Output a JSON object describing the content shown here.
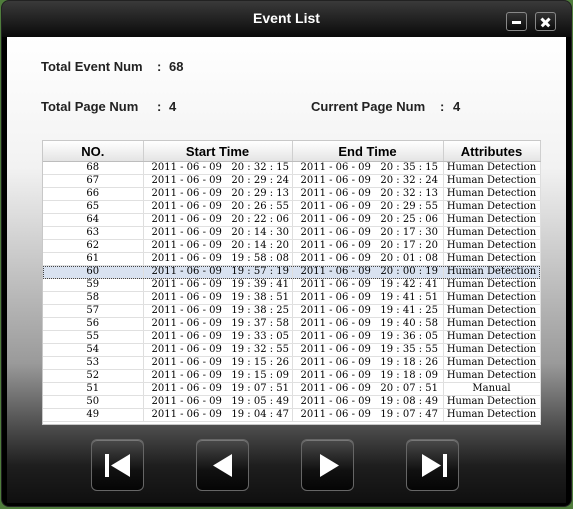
{
  "window": {
    "title": "Event List"
  },
  "info": {
    "total_event_label": "Total Event Num",
    "total_event_value": "68",
    "total_page_label": "Total Page Num",
    "total_page_value": "4",
    "current_page_label": "Current Page Num",
    "current_page_value": "4",
    "separator": ":"
  },
  "table": {
    "headers": [
      "NO.",
      "Start Time",
      "End Time",
      "Attributes"
    ],
    "rows": [
      {
        "no": "68",
        "start": "2011 - 06 - 09   20 : 32 : 15",
        "end": "2011 - 06 - 09   20 : 35 : 15",
        "attr": "Human Detection"
      },
      {
        "no": "67",
        "start": "2011 - 06 - 09   20 : 29 : 24",
        "end": "2011 - 06 - 09   20 : 32 : 24",
        "attr": "Human Detection"
      },
      {
        "no": "66",
        "start": "2011 - 06 - 09   20 : 29 : 13",
        "end": "2011 - 06 - 09   20 : 32 : 13",
        "attr": "Human Detection"
      },
      {
        "no": "65",
        "start": "2011 - 06 - 09   20 : 26 : 55",
        "end": "2011 - 06 - 09   20 : 29 : 55",
        "attr": "Human Detection"
      },
      {
        "no": "64",
        "start": "2011 - 06 - 09   20 : 22 : 06",
        "end": "2011 - 06 - 09   20 : 25 : 06",
        "attr": "Human Detection"
      },
      {
        "no": "63",
        "start": "2011 - 06 - 09   20 : 14 : 30",
        "end": "2011 - 06 - 09   20 : 17 : 30",
        "attr": "Human Detection"
      },
      {
        "no": "62",
        "start": "2011 - 06 - 09   20 : 14 : 20",
        "end": "2011 - 06 - 09   20 : 17 : 20",
        "attr": "Human Detection"
      },
      {
        "no": "61",
        "start": "2011 - 06 - 09   19 : 58 : 08",
        "end": "2011 - 06 - 09   20 : 01 : 08",
        "attr": "Human Detection"
      },
      {
        "no": "60",
        "start": "2011 - 06 - 09   19 : 57 : 19",
        "end": "2011 - 06 - 09   20 : 00 : 19",
        "attr": "Human Detection",
        "selected": true
      },
      {
        "no": "59",
        "start": "2011 - 06 - 09   19 : 39 : 41",
        "end": "2011 - 06 - 09   19 : 42 : 41",
        "attr": "Human Detection"
      },
      {
        "no": "58",
        "start": "2011 - 06 - 09   19 : 38 : 51",
        "end": "2011 - 06 - 09   19 : 41 : 51",
        "attr": "Human Detection"
      },
      {
        "no": "57",
        "start": "2011 - 06 - 09   19 : 38 : 25",
        "end": "2011 - 06 - 09   19 : 41 : 25",
        "attr": "Human Detection"
      },
      {
        "no": "56",
        "start": "2011 - 06 - 09   19 : 37 : 58",
        "end": "2011 - 06 - 09   19 : 40 : 58",
        "attr": "Human Detection"
      },
      {
        "no": "55",
        "start": "2011 - 06 - 09   19 : 33 : 05",
        "end": "2011 - 06 - 09   19 : 36 : 05",
        "attr": "Human Detection"
      },
      {
        "no": "54",
        "start": "2011 - 06 - 09   19 : 32 : 55",
        "end": "2011 - 06 - 09   19 : 35 : 55",
        "attr": "Human Detection"
      },
      {
        "no": "53",
        "start": "2011 - 06 - 09   19 : 15 : 26",
        "end": "2011 - 06 - 09   19 : 18 : 26",
        "attr": "Human Detection"
      },
      {
        "no": "52",
        "start": "2011 - 06 - 09   19 : 15 : 09",
        "end": "2011 - 06 - 09   19 : 18 : 09",
        "attr": "Human Detection"
      },
      {
        "no": "51",
        "start": "2011 - 06 - 09   19 : 07 : 51",
        "end": "2011 - 06 - 09   20 : 07 : 51",
        "attr": "Manual"
      },
      {
        "no": "50",
        "start": "2011 - 06 - 09   19 : 05 : 49",
        "end": "2011 - 06 - 09   19 : 08 : 49",
        "attr": "Human Detection"
      },
      {
        "no": "49",
        "start": "2011 - 06 - 09   19 : 04 : 47",
        "end": "2011 - 06 - 09   19 : 07 : 47",
        "attr": "Human Detection"
      }
    ]
  },
  "nav": {
    "first_icon": "first-page-icon",
    "prev_icon": "previous-page-icon",
    "next_icon": "next-page-icon",
    "last_icon": "last-page-icon"
  },
  "colors": {
    "selected_row": "#d9e2f0",
    "titlebar": "#0a0a0a"
  }
}
